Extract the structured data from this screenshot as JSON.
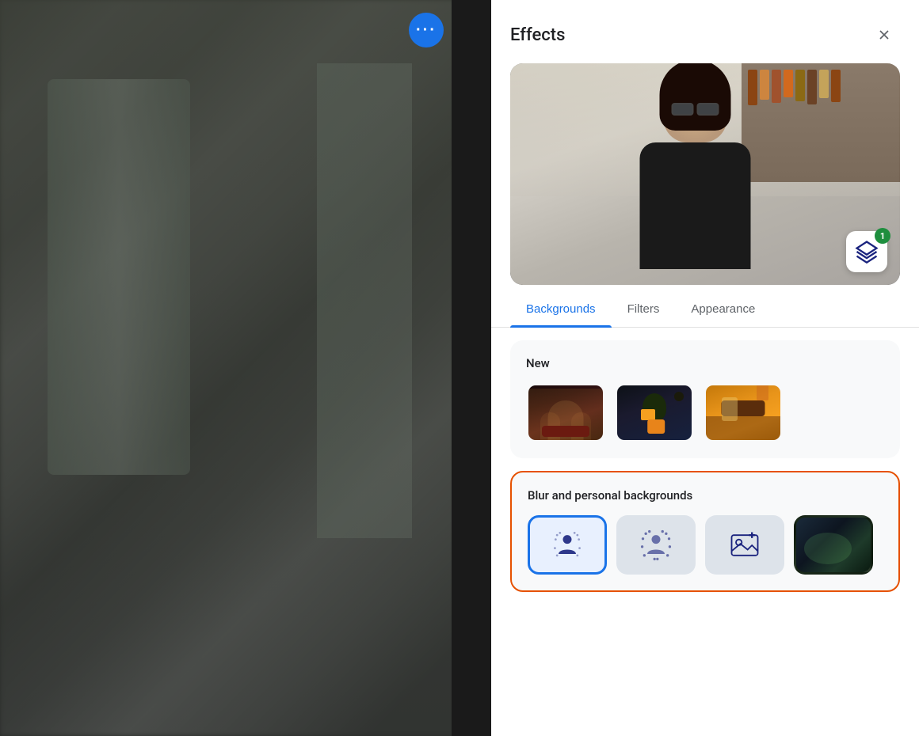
{
  "videoArea": {
    "moreOptionsLabel": "···"
  },
  "effectsPanel": {
    "title": "Effects",
    "closeButton": "×",
    "tabs": [
      {
        "id": "backgrounds",
        "label": "Backgrounds",
        "active": true
      },
      {
        "id": "filters",
        "label": "Filters",
        "active": false
      },
      {
        "id": "appearance",
        "label": "Appearance",
        "active": false
      }
    ],
    "sections": {
      "new": {
        "title": "New",
        "thumbnails": [
          {
            "id": "gothic",
            "alt": "Gothic hall background"
          },
          {
            "id": "halloween",
            "alt": "Halloween night background"
          },
          {
            "id": "cozy",
            "alt": "Cozy room background"
          }
        ]
      },
      "blurPersonal": {
        "title": "Blur and personal backgrounds",
        "items": [
          {
            "id": "blur-portrait",
            "label": "Portrait blur",
            "selected": true
          },
          {
            "id": "blur-background",
            "label": "Background blur",
            "selected": false
          },
          {
            "id": "add-image",
            "label": "Add image",
            "selected": false
          },
          {
            "id": "custom-bg",
            "label": "Custom background",
            "selected": false
          }
        ]
      }
    }
  },
  "previewBadge": {
    "count": "1"
  }
}
